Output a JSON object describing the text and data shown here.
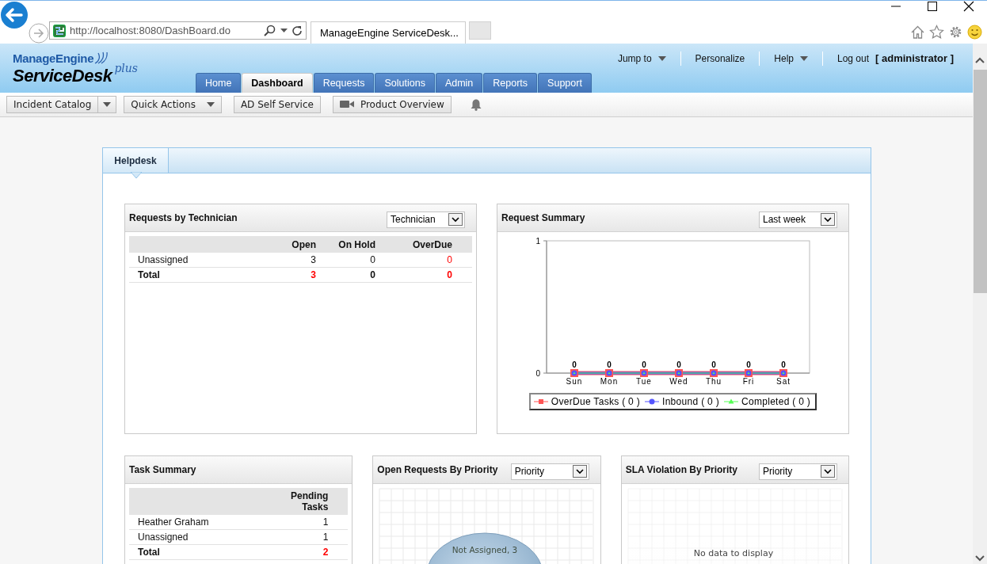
{
  "browser": {
    "url": "http://localhost:8080/DashBoard.do",
    "tab_title": "ManageEngine ServiceDesk..."
  },
  "logo": {
    "company": "ManageEngine",
    "product": "ServiceDesk",
    "edition": "plus"
  },
  "top_links": [
    {
      "label": "Jump to",
      "kind": "dropdown"
    },
    {
      "label": "Personalize",
      "kind": "link"
    },
    {
      "label": "Help",
      "kind": "dropdown"
    },
    {
      "label": "Log out **[ administrator ]**",
      "kind": "user"
    }
  ],
  "nav_tabs": [
    {
      "label": "Home",
      "selected": false
    },
    {
      "label": "Dashboard",
      "selected": true
    },
    {
      "label": "Requests",
      "selected": false
    },
    {
      "label": "Solutions",
      "selected": false
    },
    {
      "label": "Admin",
      "selected": false
    },
    {
      "label": "Reports",
      "selected": false
    },
    {
      "label": "Support",
      "selected": false
    }
  ],
  "toolbar": [
    {
      "label": "Incident Catalog",
      "kind": "split"
    },
    {
      "label": "Quick Actions",
      "kind": "menu"
    },
    {
      "label": "AD Self Service",
      "kind": "plain"
    },
    {
      "label": "Product Overview",
      "kind": "video"
    },
    {
      "kind": "bell"
    }
  ],
  "dashboard_tabs": [
    {
      "label": "Helpdesk",
      "selected": true
    }
  ],
  "widget_rows": [
    [
      {
        "kind": "table",
        "title": "Requests by Technician",
        "filter": "Technician",
        "columns": [
          "Open",
          "On Hold",
          "OverDue"
        ],
        "rows": [
          {
            "name": "Unassigned",
            "total": false,
            "values": [
              {
                "text": "3",
                "alert": false
              },
              {
                "text": "0",
                "alert": false
              },
              {
                "text": "0",
                "alert": true
              }
            ]
          },
          {
            "name": "Total",
            "total": true,
            "values": [
              {
                "text": "3",
                "alert": true
              },
              {
                "text": "0",
                "alert": false
              },
              {
                "text": "0",
                "alert": true
              }
            ]
          }
        ]
      },
      {
        "kind": "chart",
        "title": "Request Summary",
        "filter": "Last week",
        "chart_data": {
          "type": "line",
          "categories": [
            "Sun",
            "Mon",
            "Tue",
            "Wed",
            "Thu",
            "Fri",
            "Sat"
          ],
          "ylim": [
            0,
            1
          ],
          "yticks": [
            0,
            1
          ],
          "series": [
            {
              "name": "OverDue Tasks ( 0 )",
              "color": "#ff5555",
              "marker": "square",
              "values": [
                0,
                0,
                0,
                0,
                0,
                0,
                0
              ],
              "value_labels": [
                null,
                null,
                null,
                null,
                null,
                null,
                null
              ]
            },
            {
              "name": "Inbound ( 0 )",
              "color": "#5555ff",
              "marker": "circle",
              "values": [
                0,
                0,
                0,
                0,
                0,
                0,
                0
              ],
              "value_labels": [
                null,
                null,
                null,
                null,
                null,
                null,
                null
              ]
            },
            {
              "name": "Completed ( 0 )",
              "color": "#55ff55",
              "marker": "triangle",
              "values": [
                0,
                0,
                0,
                0,
                0,
                0,
                0
              ],
              "value_labels": [
                "0",
                "0",
                "0",
                "0",
                "0",
                "0",
                "0"
              ]
            }
          ]
        }
      }
    ],
    [
      {
        "kind": "table",
        "title": "Task Summary",
        "columns": [
          "Pending Tasks"
        ],
        "rows": [
          {
            "name": "Heather Graham",
            "total": false,
            "values": [
              {
                "text": "1",
                "alert": false
              }
            ]
          },
          {
            "name": "Unassigned",
            "total": false,
            "values": [
              {
                "text": "1",
                "alert": false
              }
            ]
          },
          {
            "name": "Total",
            "total": true,
            "values": [
              {
                "text": "2",
                "alert": true
              }
            ]
          }
        ]
      },
      {
        "kind": "pie",
        "title": "Open Requests By Priority",
        "filter": "Priority",
        "slice_label": "Not Assigned, 3"
      },
      {
        "kind": "empty",
        "title": "SLA Violation By Priority",
        "filter": "Priority",
        "message": "No data to display"
      }
    ]
  ]
}
